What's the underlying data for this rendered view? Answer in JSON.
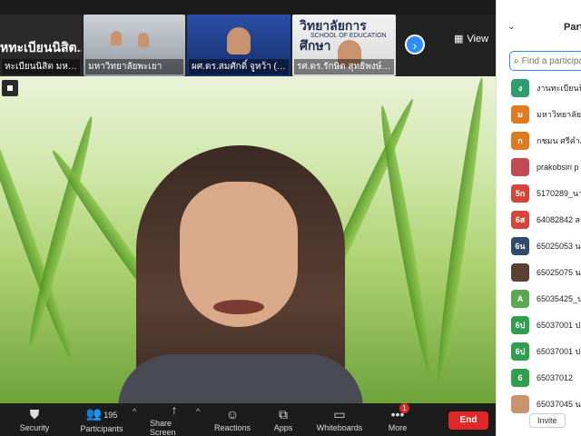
{
  "thumbnails": [
    {
      "label": "หะเบียนนิสิต มหาวิทยา",
      "big": "หทะเบียนนิสิต..."
    },
    {
      "label": "มหาวิทยาลัยพะเยา"
    },
    {
      "label": "ผศ.ดร.สมศักดิ์ จูหว้า (สาธา..."
    },
    {
      "label": "รศ.ดร.รักษิต สุทธิพงษ์ (วศ.)",
      "sign": "วิทยาลัยการศึกษา",
      "sign_sub": "SCHOOL OF EDUCATION"
    }
  ],
  "view_label": "View",
  "next_icon": "›",
  "toolbar": {
    "security": "Security",
    "participants": "Participants",
    "participants_count": "195",
    "share": "Share Screen",
    "reactions": "Reactions",
    "apps": "Apps",
    "whiteboards": "Whiteboards",
    "more": "More",
    "more_badge": "1",
    "end": "End"
  },
  "panel": {
    "title": "Parti",
    "search_placeholder": "Find a participant",
    "invite": "Invite",
    "participants": [
      {
        "initial": "ง",
        "name": "งานทะเบียนนิสิ",
        "color": "#2e9e6f"
      },
      {
        "initial": "ม",
        "name": "มหาวิทยาลัยพ",
        "color": "#e07a1f"
      },
      {
        "initial": "ก",
        "name": "กชมน ศรีคำภ",
        "color": "#e07a1f"
      },
      {
        "initial": "",
        "name": "prakobsiri p",
        "color": "#c24a52"
      },
      {
        "initial": "5ก",
        "name": "5170289_นา",
        "color": "#d6453c"
      },
      {
        "initial": "6ส",
        "name": "64082842 ส",
        "color": "#d6453c"
      },
      {
        "initial": "6น",
        "name": "65025053 น",
        "color": "#2e4a6e"
      },
      {
        "initial": "",
        "name": "65025075 น",
        "color": "#5a3f33"
      },
      {
        "initial": "A",
        "name": "65035425_น",
        "color": "#5aa850"
      },
      {
        "initial": "6ป",
        "name": "65037001 ป",
        "color": "#2e9e4f"
      },
      {
        "initial": "6ป",
        "name": "65037001 ป",
        "color": "#2e9e4f"
      },
      {
        "initial": "6",
        "name": "65037012",
        "color": "#2e9e4f"
      },
      {
        "initial": "",
        "name": "65037045 น",
        "color": "#c9936f"
      }
    ]
  }
}
